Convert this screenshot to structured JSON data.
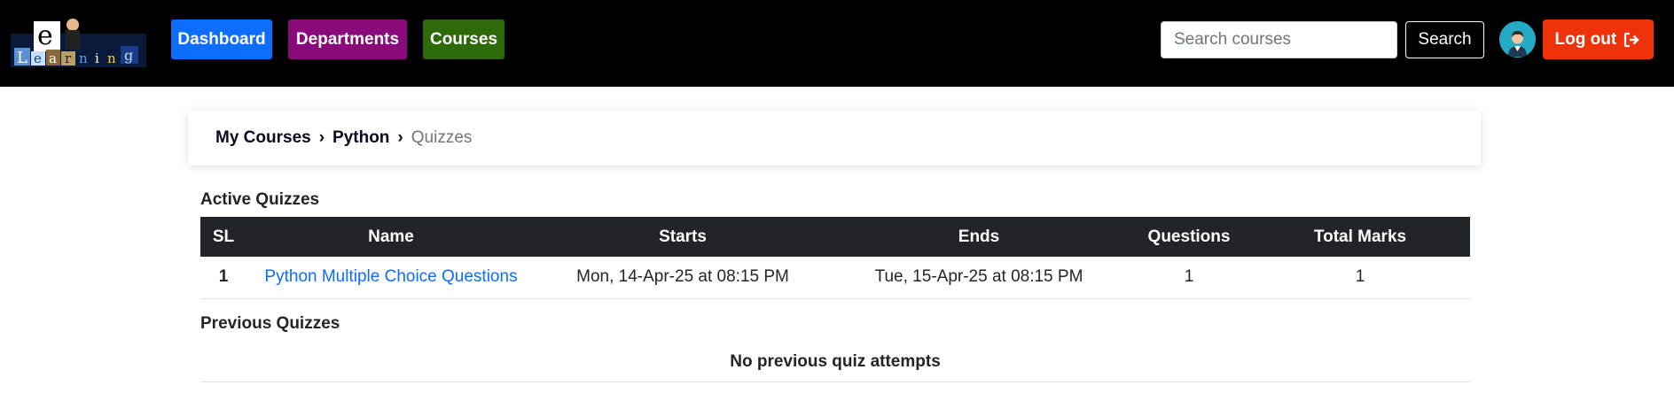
{
  "nav": {
    "logo_alt": "eLearning",
    "dashboard_label": "Dashboard",
    "departments_label": "Departments",
    "courses_label": "Courses",
    "search_placeholder": "Search courses",
    "search_value": "",
    "search_button_label": "Search",
    "logout_label": "Log out"
  },
  "breadcrumb": {
    "items": [
      {
        "label": "My Courses"
      },
      {
        "label": "Python"
      },
      {
        "label": "Quizzes"
      }
    ]
  },
  "active_quizzes": {
    "title": "Active Quizzes",
    "columns": [
      "SL",
      "Name",
      "Starts",
      "Ends",
      "Questions",
      "Total Marks"
    ],
    "rows": [
      {
        "sl": "1",
        "name": "Python Multiple Choice Questions",
        "starts": "Mon, 14-Apr-25 at 08:15 PM",
        "ends": "Tue, 15-Apr-25 at 08:15 PM",
        "questions": "1",
        "total_marks": "1"
      }
    ]
  },
  "previous_quizzes": {
    "title": "Previous Quizzes",
    "empty_message": "No previous quiz attempts"
  },
  "colors": {
    "navbar_bg": "#000000",
    "dashboard": "#0d6efd",
    "departments": "#8b0a7b",
    "courses": "#2d6a0a",
    "logout": "#f0320a",
    "table_header": "#212529",
    "link": "#0d6efd"
  }
}
